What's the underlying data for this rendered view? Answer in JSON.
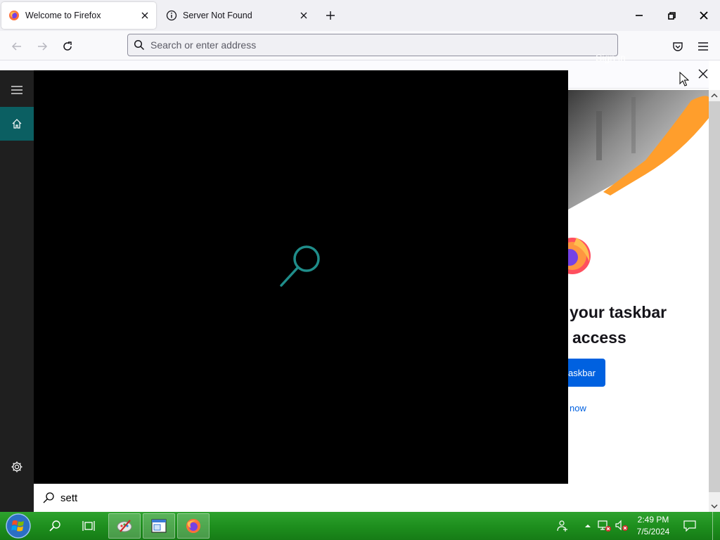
{
  "browser": {
    "tabs": [
      {
        "title": "Welcome to Firefox",
        "active": true
      },
      {
        "title": "Server Not Found",
        "active": false
      }
    ],
    "urlbar": {
      "placeholder": "Search or enter address"
    }
  },
  "page": {
    "sign_in": "Sign in",
    "heading_line1": "your taskbar",
    "heading_line2": "access",
    "pin_button": "askbar",
    "not_now": "now"
  },
  "search_panel": {
    "query": "sett",
    "accent": "#0b5f62"
  },
  "taskbar": {
    "clock_time": "2:49 PM",
    "clock_date": "7/5/2024",
    "color": "#1e8f1e"
  }
}
